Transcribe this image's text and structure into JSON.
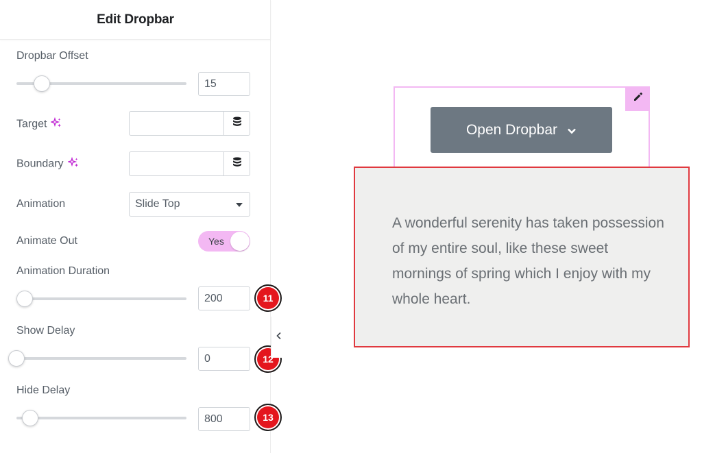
{
  "panel": {
    "title": "Edit Dropbar",
    "fields": {
      "dropbar_offset": {
        "label": "Dropbar Offset",
        "value": "15",
        "fill": 0.15
      },
      "target": {
        "label": "Target",
        "value": "",
        "icon": "sparkle-icon",
        "button_icon": "database-icon"
      },
      "boundary": {
        "label": "Boundary",
        "value": "",
        "icon": "sparkle-icon",
        "button_icon": "database-icon"
      },
      "animation": {
        "label": "Animation",
        "value": "Slide Top"
      },
      "animate_out": {
        "label": "Animate Out",
        "value": "Yes",
        "enabled": true
      },
      "animation_duration": {
        "label": "Animation Duration",
        "value": "200",
        "badge": "11",
        "fill": 0.05
      },
      "show_delay": {
        "label": "Show Delay",
        "value": "0",
        "badge": "12",
        "fill": 0.0
      },
      "hide_delay": {
        "label": "Hide Delay",
        "value": "800",
        "badge": "13",
        "fill": 0.08
      }
    },
    "collapse_icon": "chevron-left-icon"
  },
  "preview": {
    "button_label": "Open Dropbar",
    "button_icon": "chevron-down-icon",
    "edit_icon": "pencil-icon",
    "dropbar_text": "A wonderful serenity has taken possession of my entire soul, like these sweet mornings of spring which I enjoy with my whole heart."
  },
  "colors": {
    "accent_pink": "#f3b8f3",
    "button_gray": "#6d7882",
    "dropbar_bg": "#efefee",
    "dropbar_border": "#e0393f",
    "badge_red": "#e4161d",
    "sparkle_purple": "#c026d3"
  }
}
